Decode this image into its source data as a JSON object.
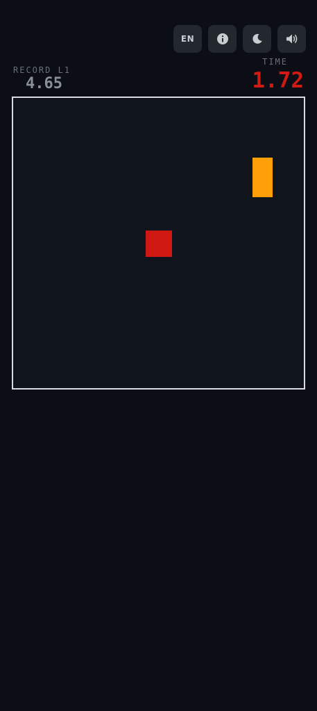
{
  "toolbar": {
    "language_label": "EN",
    "info_icon": "info-icon",
    "theme_icon": "moon-icon",
    "sound_icon": "speaker-icon"
  },
  "record": {
    "label": "RECORD L1",
    "value": "4.65"
  },
  "time": {
    "label": "TIME",
    "value": "1.72"
  },
  "arena": {
    "player_color": "#d01812",
    "enemy_color": "#ff9f0a",
    "border_color": "#d9dbde"
  }
}
